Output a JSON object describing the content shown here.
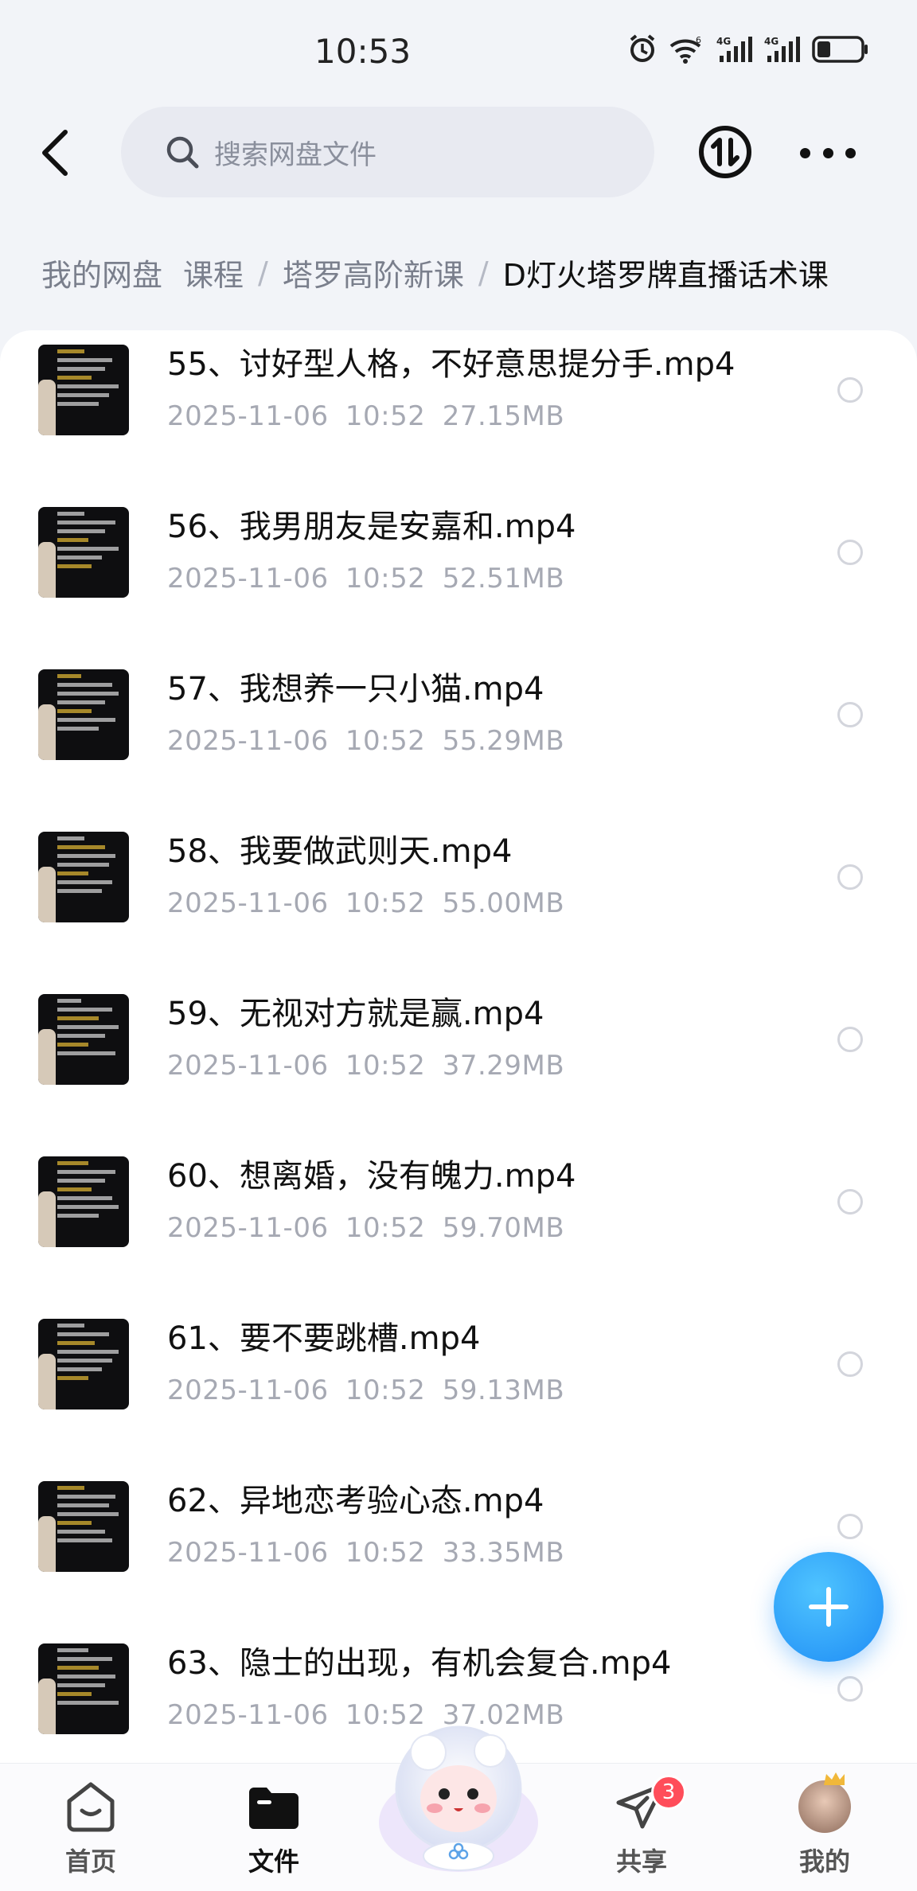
{
  "status_bar": {
    "time": "10:53",
    "icons": [
      "alarm-icon",
      "wifi-6-icon",
      "4g-signal-icon",
      "4g-signal-icon",
      "battery-icon"
    ]
  },
  "header": {
    "search_placeholder": "搜索网盘文件"
  },
  "breadcrumb": {
    "home": "我的网盘",
    "items": [
      "课程",
      "塔罗高阶新课",
      "D灯火塔罗牌直播话术课"
    ]
  },
  "files": [
    {
      "name": "55、讨好型人格，不好意思提分手.mp4",
      "date": "2025-11-06",
      "time": "10:52",
      "size": "27.15MB"
    },
    {
      "name": "56、我男朋友是安嘉和.mp4",
      "date": "2025-11-06",
      "time": "10:52",
      "size": "52.51MB"
    },
    {
      "name": "57、我想养一只小猫.mp4",
      "date": "2025-11-06",
      "time": "10:52",
      "size": "55.29MB"
    },
    {
      "name": "58、我要做武则天.mp4",
      "date": "2025-11-06",
      "time": "10:52",
      "size": "55.00MB"
    },
    {
      "name": "59、无视对方就是赢.mp4",
      "date": "2025-11-06",
      "time": "10:52",
      "size": "37.29MB"
    },
    {
      "name": "60、想离婚，没有魄力.mp4",
      "date": "2025-11-06",
      "time": "10:52",
      "size": "59.70MB"
    },
    {
      "name": "61、要不要跳槽.mp4",
      "date": "2025-11-06",
      "time": "10:52",
      "size": "59.13MB"
    },
    {
      "name": "62、异地恋考验心态.mp4",
      "date": "2025-11-06",
      "time": "10:52",
      "size": "33.35MB"
    },
    {
      "name": "63、隐士的出现，有机会复合.mp4",
      "date": "2025-11-06",
      "time": "10:52",
      "size": "37.02MB"
    }
  ],
  "bottom_nav": {
    "home": "首页",
    "files": "文件",
    "share": "共享",
    "share_badge": "3",
    "mine": "我的"
  },
  "colors": {
    "accent": "#1e8cf5",
    "badge": "#ff4d5a",
    "meta_text": "#a6a9b3"
  }
}
